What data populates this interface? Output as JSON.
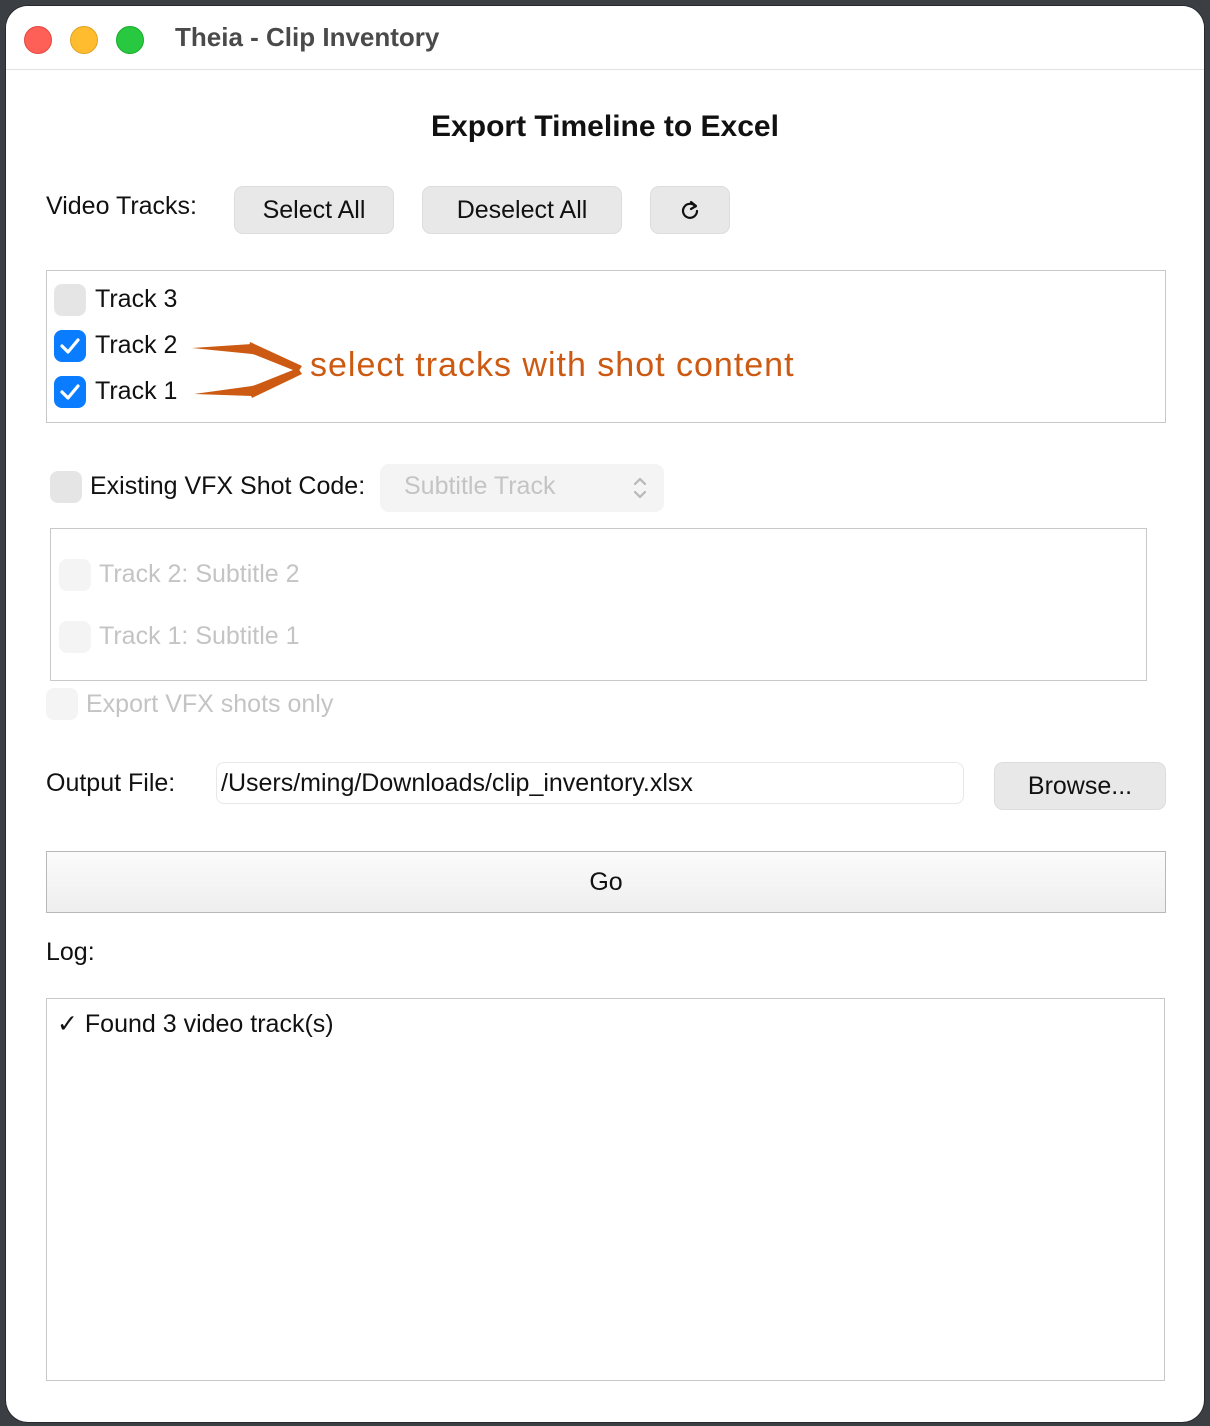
{
  "window": {
    "title": "Theia - Clip Inventory"
  },
  "heading": "Export Timeline to Excel",
  "video_tracks": {
    "label": "Video Tracks:",
    "select_all_label": "Select All",
    "deselect_all_label": "Deselect All",
    "refresh_icon": "refresh-icon",
    "tracks": [
      {
        "label": "Track 3",
        "checked": false
      },
      {
        "label": "Track 2",
        "checked": true
      },
      {
        "label": "Track 1",
        "checked": true
      }
    ]
  },
  "annotation": {
    "text": "select tracks with shot content",
    "color": "#cc5a12"
  },
  "vfx": {
    "checkbox_label": "Existing VFX Shot Code:",
    "checked": false,
    "select_value": "Subtitle Track",
    "subtitle_tracks": [
      {
        "label": "Track 2: Subtitle 2",
        "checked": false
      },
      {
        "label": "Track 1: Subtitle 1",
        "checked": false
      }
    ],
    "export_only_label": "Export VFX shots only"
  },
  "output": {
    "label": "Output File:",
    "value": "/Users/ming/Downloads/clip_inventory.xlsx",
    "browse_label": "Browse..."
  },
  "go_label": "Go",
  "log": {
    "label": "Log:",
    "lines": [
      "✓ Found 3 video track(s)"
    ]
  },
  "colors": {
    "accent": "#0a7cff",
    "close": "#fe5f57",
    "minimize": "#febc2e",
    "zoom": "#28c840"
  }
}
